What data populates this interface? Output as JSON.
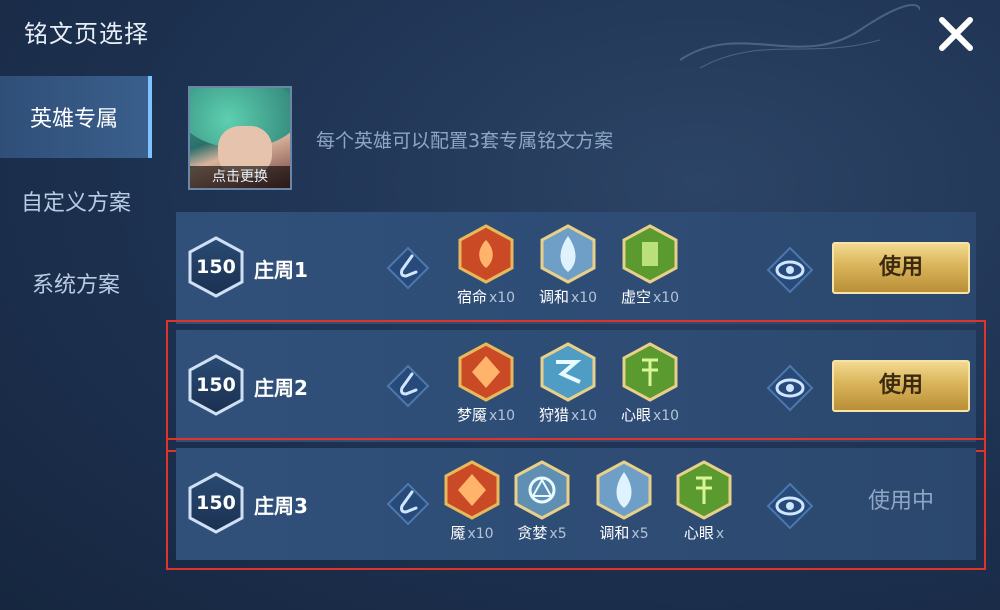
{
  "window": {
    "title": "铭文页选择"
  },
  "sidebar": {
    "items": [
      {
        "label": "英雄专属",
        "active": true
      },
      {
        "label": "自定义方案",
        "active": false
      },
      {
        "label": "系统方案",
        "active": false
      }
    ]
  },
  "hero": {
    "change_label": "点击更换",
    "hint": "每个英雄可以配置3套专属铭文方案"
  },
  "plans": [
    {
      "level": "150",
      "name": "庄周1",
      "runes": [
        {
          "name": "宿命",
          "count": "x10",
          "color": "#d8532b"
        },
        {
          "name": "调和",
          "count": "x10",
          "color": "#8fb8d8"
        },
        {
          "name": "虚空",
          "count": "x10",
          "color": "#6fae3b"
        }
      ],
      "action": "使用"
    },
    {
      "level": "150",
      "name": "庄周2",
      "runes": [
        {
          "name": "梦魇",
          "count": "x10",
          "color": "#d8532b"
        },
        {
          "name": "狩猎",
          "count": "x10",
          "color": "#5fb6d9"
        },
        {
          "name": "心眼",
          "count": "x10",
          "color": "#6fae3b"
        }
      ],
      "action": "使用"
    },
    {
      "level": "150",
      "name": "庄周3",
      "runes": [
        {
          "name": "魇",
          "count": "x10",
          "color": "#d8532b"
        },
        {
          "name": "贪婪",
          "count": "x5",
          "color": "#7fb0d2"
        },
        {
          "name": "调和",
          "count": "x5",
          "color": "#8fb8d8"
        },
        {
          "name": "心眼",
          "count": "x",
          "color": "#6fae3b"
        }
      ],
      "action": "使用中"
    }
  ],
  "icons": {
    "close": "close-icon",
    "edit": "edit-icon",
    "view": "eye-icon"
  }
}
